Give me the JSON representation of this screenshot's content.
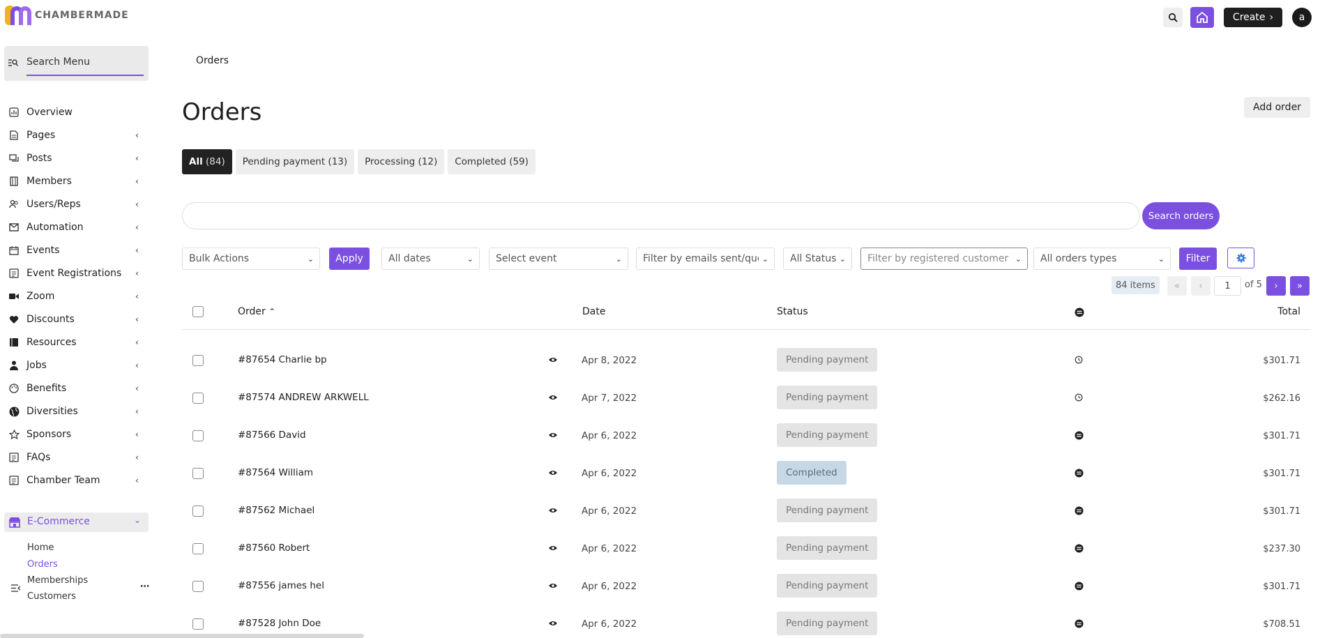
{
  "app": {
    "logo_text": "CHAMBERMADE"
  },
  "topbar": {
    "create_label": "Create",
    "avatar_letter": "a"
  },
  "sidebar": {
    "search_placeholder": "Search Menu",
    "items": [
      {
        "label": "Overview",
        "icon": "overview-icon",
        "chev": false
      },
      {
        "label": "Pages",
        "icon": "pages-icon",
        "chev": true
      },
      {
        "label": "Posts",
        "icon": "posts-icon",
        "chev": true
      },
      {
        "label": "Members",
        "icon": "members-icon",
        "chev": true
      },
      {
        "label": "Users/Reps",
        "icon": "users-icon",
        "chev": true
      },
      {
        "label": "Automation",
        "icon": "mail-icon",
        "chev": true
      },
      {
        "label": "Events",
        "icon": "calendar-icon",
        "chev": true
      },
      {
        "label": "Event Registrations",
        "icon": "registrations-icon",
        "chev": true
      },
      {
        "label": "Zoom",
        "icon": "video-icon",
        "chev": true
      },
      {
        "label": "Discounts",
        "icon": "heart-icon",
        "chev": true
      },
      {
        "label": "Resources",
        "icon": "book-icon",
        "chev": true
      },
      {
        "label": "Jobs",
        "icon": "person-icon",
        "chev": true
      },
      {
        "label": "Benefits",
        "icon": "palette-icon",
        "chev": true
      },
      {
        "label": "Diversities",
        "icon": "globe-icon",
        "chev": true
      },
      {
        "label": "Sponsors",
        "icon": "star-icon",
        "chev": true
      },
      {
        "label": "FAQs",
        "icon": "faq-icon",
        "chev": true
      },
      {
        "label": "Chamber Team",
        "icon": "team-icon",
        "chev": true
      }
    ],
    "ecommerce": {
      "label": "E-Commerce",
      "sub": [
        "Home",
        "Orders",
        "Memberships",
        "Customers"
      ],
      "active_sub": "Orders"
    }
  },
  "main": {
    "breadcrumb": "Orders",
    "title": "Orders",
    "add_order": "Add order",
    "tabs": [
      {
        "label": "All",
        "count": "(84)",
        "active": true
      },
      {
        "label": "Pending payment",
        "count": "(13)"
      },
      {
        "label": "Processing",
        "count": "(12)"
      },
      {
        "label": "Completed",
        "count": "(59)"
      }
    ],
    "search_button": "Search orders",
    "filters": {
      "bulk_actions": "Bulk Actions",
      "apply": "Apply",
      "dates": "All dates",
      "event": "Select event",
      "emails": "Filter by emails sent/queued",
      "status": "All Status",
      "customer_placeholder": "Filter by registered customer",
      "order_types": "All orders types",
      "filter": "Filter"
    },
    "pagination": {
      "items": "84 items",
      "first": "«",
      "prev": "‹",
      "page": "1",
      "of": "of 5",
      "next": "›",
      "last": "»"
    },
    "table": {
      "headers": {
        "order": "Order",
        "date": "Date",
        "status": "Status",
        "total": "Total"
      },
      "rows": [
        {
          "order": "#87654 Charlie bp",
          "date": "Apr 8, 2022",
          "status": "Pending payment",
          "action_icon": "history-icon",
          "total": "$301.71"
        },
        {
          "order": "#87574 ANDREW ARKWELL",
          "date": "Apr 7, 2022",
          "status": "Pending payment",
          "action_icon": "history-icon",
          "total": "$262.16"
        },
        {
          "order": "#87566 David",
          "date": "Apr 6, 2022",
          "status": "Pending payment",
          "action_icon": "email-status-icon",
          "total": "$301.71"
        },
        {
          "order": "#87564 William",
          "date": "Apr 6, 2022",
          "status": "Completed",
          "action_icon": "email-status-icon",
          "total": "$301.71"
        },
        {
          "order": "#87562 Michael",
          "date": "Apr 6, 2022",
          "status": "Pending payment",
          "action_icon": "email-status-icon",
          "total": "$301.71"
        },
        {
          "order": "#87560 Robert",
          "date": "Apr 6, 2022",
          "status": "Pending payment",
          "action_icon": "email-status-icon",
          "total": "$237.30"
        },
        {
          "order": "#87556 james hel",
          "date": "Apr 6, 2022",
          "status": "Pending payment",
          "action_icon": "email-status-icon",
          "total": "$301.71"
        },
        {
          "order": "#87528 John Doe",
          "date": "Apr 6, 2022",
          "status": "Pending payment",
          "action_icon": "email-status-icon",
          "total": "$708.51"
        }
      ]
    }
  },
  "colors": {
    "accent": "#7b4fe0",
    "dark": "#1f1f1f",
    "pending_bg": "#e4e4e4",
    "completed_bg": "#c6d7e6"
  }
}
